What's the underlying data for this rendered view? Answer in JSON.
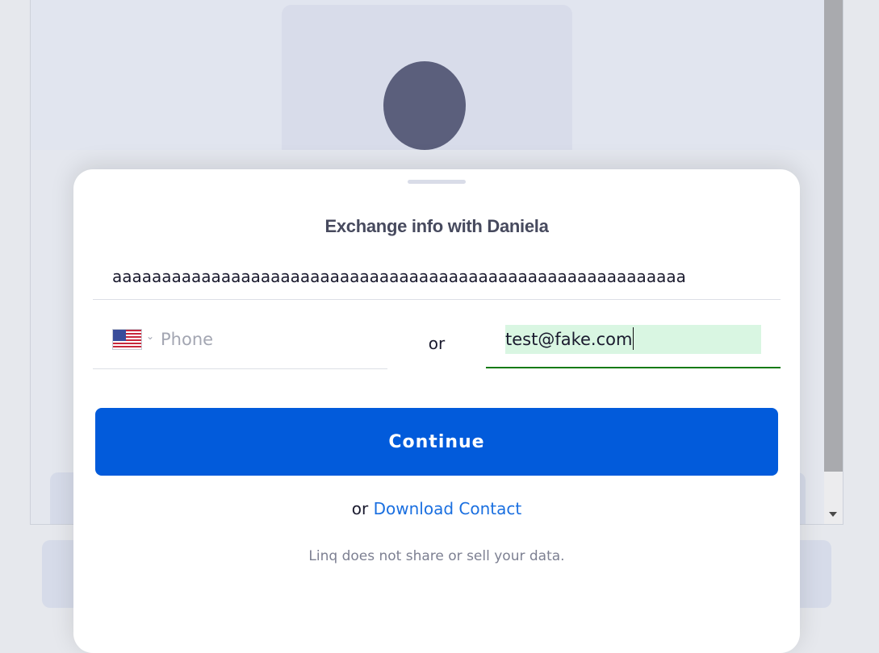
{
  "modal": {
    "title": "Exchange info with Daniela",
    "name_value": "aaaaaaaaaaaaaaaaaaaaaaaaaaaaaaaaaaaaaaaaaaaaaaaaaaaaaaaaaa",
    "phone_placeholder": "Phone",
    "phone_value": "",
    "country_flag": "us-flag-icon",
    "or_label": "or",
    "email_value": "test@fake.com",
    "continue_label": "Continue",
    "download_prefix": "or",
    "download_label": "Download Contact",
    "privacy_note": "Linq does not share or sell your data."
  },
  "colors": {
    "primary_button": "#025bdb",
    "link": "#1a6fe0",
    "email_valid_border": "#157a15",
    "email_autofill_bg": "#d9f6e2",
    "avatar": "#5b5f7c"
  }
}
